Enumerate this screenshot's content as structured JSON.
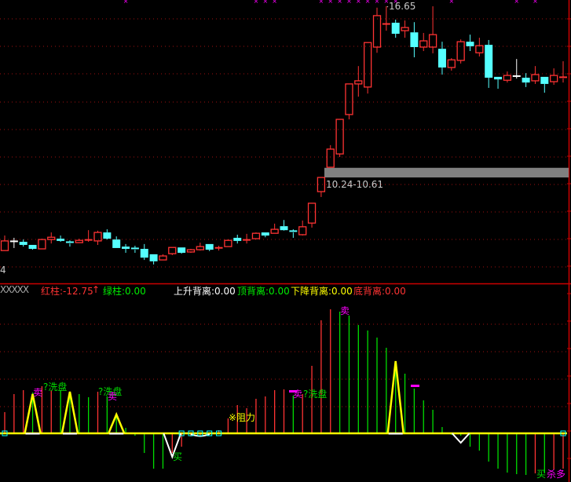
{
  "colors": {
    "up": "#ff3333",
    "down": "#55ffff",
    "doji": "#ffffff",
    "grid": "#a01010",
    "axis": "#cc0000",
    "marker": "#ff00ff",
    "yellow": "#ffff00",
    "green": "#00dd00",
    "magenta": "#ff00ff",
    "gap": "#808080"
  },
  "price_panel": {
    "high_label": "16.65",
    "gap_label": "10.24-10.61",
    "axis_fragment": "4",
    "price_range": [
      7.3,
      16.85
    ]
  },
  "indicator_header": {
    "name": "XXXXX",
    "red_bar": "红柱:-12.75",
    "red_arrow": "↑",
    "green_bar": "绿柱:0.00",
    "rise_divergence": "上升背离:0.00",
    "top_divergence": "顶背离:0.00",
    "fall_divergence": "下降背离:0.00",
    "bottom_divergence": "底背离:0.00"
  },
  "signals": {
    "sell_1": "卖",
    "wash_1": "?洗盘",
    "wash_2": "?洗盘",
    "sell_2": "卖",
    "buy_1": "买",
    "resistance": "※阻力",
    "sell_3": "卖",
    "wash_3": "?洗盘",
    "sell_4": "卖",
    "buy_2": "买",
    "kill_long": "杀多"
  },
  "chart_data": {
    "type": "candlestick",
    "ohlc": [
      [
        8.03,
        8.56,
        8.03,
        8.37
      ],
      [
        8.37,
        8.48,
        8.12,
        8.37
      ],
      [
        8.34,
        8.42,
        8.17,
        8.23
      ],
      [
        8.23,
        8.23,
        8.06,
        8.09
      ],
      [
        8.09,
        8.45,
        8.09,
        8.42
      ],
      [
        8.42,
        8.67,
        8.28,
        8.5
      ],
      [
        8.45,
        8.56,
        8.34,
        8.37
      ],
      [
        8.34,
        8.39,
        8.17,
        8.28
      ],
      [
        8.31,
        8.45,
        8.31,
        8.39
      ],
      [
        8.39,
        8.75,
        8.34,
        8.42
      ],
      [
        8.37,
        8.73,
        8.23,
        8.67
      ],
      [
        8.67,
        8.78,
        8.42,
        8.45
      ],
      [
        8.42,
        8.53,
        8.12,
        8.12
      ],
      [
        8.17,
        8.26,
        7.95,
        8.09
      ],
      [
        8.12,
        8.2,
        7.95,
        8.06
      ],
      [
        8.09,
        8.26,
        7.7,
        7.78
      ],
      [
        7.9,
        7.9,
        7.54,
        7.65
      ],
      [
        7.7,
        7.9,
        7.7,
        7.84
      ],
      [
        7.92,
        8.14,
        7.87,
        8.14
      ],
      [
        8.14,
        8.14,
        7.92,
        7.95
      ],
      [
        7.98,
        8.09,
        7.95,
        8.06
      ],
      [
        8.06,
        8.31,
        8.03,
        8.17
      ],
      [
        8.26,
        8.26,
        8.01,
        8.06
      ],
      [
        8.12,
        8.2,
        8.03,
        8.14
      ],
      [
        8.17,
        8.42,
        8.17,
        8.39
      ],
      [
        8.48,
        8.59,
        8.28,
        8.37
      ],
      [
        8.39,
        8.62,
        8.28,
        8.42
      ],
      [
        8.45,
        8.67,
        8.45,
        8.64
      ],
      [
        8.67,
        8.67,
        8.5,
        8.56
      ],
      [
        8.64,
        8.98,
        8.64,
        8.78
      ],
      [
        8.89,
        9.11,
        8.73,
        8.75
      ],
      [
        8.73,
        8.78,
        8.48,
        8.67
      ],
      [
        8.59,
        9.09,
        8.56,
        8.87
      ],
      [
        9.0,
        9.7,
        8.84,
        9.7
      ],
      [
        10.11,
        10.61,
        9.92,
        10.61
      ],
      [
        10.97,
        11.75,
        10.97,
        11.61
      ],
      [
        11.44,
        12.66,
        11.33,
        12.66
      ],
      [
        12.83,
        13.91,
        12.66,
        13.91
      ],
      [
        13.91,
        14.54,
        13.46,
        14.02
      ],
      [
        13.8,
        15.37,
        13.57,
        15.37
      ],
      [
        15.21,
        16.6,
        15.01,
        16.32
      ],
      [
        16.01,
        16.65,
        15.79,
        16.04
      ],
      [
        16.07,
        16.18,
        15.54,
        15.68
      ],
      [
        15.79,
        16.15,
        15.54,
        15.9
      ],
      [
        15.73,
        16.09,
        14.85,
        15.21
      ],
      [
        15.21,
        15.71,
        15.07,
        15.43
      ],
      [
        15.21,
        16.65,
        14.99,
        15.65
      ],
      [
        15.15,
        15.4,
        14.24,
        14.49
      ],
      [
        14.49,
        14.82,
        14.38,
        14.76
      ],
      [
        14.74,
        15.48,
        14.63,
        15.4
      ],
      [
        15.4,
        15.65,
        15.07,
        15.24
      ],
      [
        15.01,
        15.54,
        14.88,
        15.26
      ],
      [
        15.29,
        15.46,
        13.77,
        14.13
      ],
      [
        14.16,
        14.16,
        13.74,
        14.07
      ],
      [
        14.04,
        14.35,
        13.96,
        14.21
      ],
      [
        14.2,
        14.79,
        14.1,
        14.2
      ],
      [
        14.13,
        14.29,
        13.8,
        13.96
      ],
      [
        14.02,
        14.54,
        13.91,
        14.24
      ],
      [
        14.16,
        14.16,
        13.6,
        13.91
      ],
      [
        13.99,
        14.46,
        13.88,
        14.21
      ],
      [
        14.1,
        14.71,
        13.96,
        14.16
      ]
    ],
    "doji_white": [
      1,
      55
    ],
    "top_markers": [
      13,
      27,
      28,
      29,
      34,
      35,
      36,
      37,
      38,
      39,
      40,
      41,
      42,
      48,
      55,
      57
    ],
    "gap_zone": [
      10.61,
      10.95
    ],
    "indicator": {
      "values": [
        27,
        50,
        55,
        52,
        60,
        55,
        55,
        53,
        50,
        46,
        53,
        47,
        23,
        7,
        -3,
        -25,
        -45,
        -45,
        -25,
        -17,
        -4,
        -3,
        -2,
        4,
        19,
        36,
        32,
        44,
        47,
        55,
        56,
        48,
        50,
        86,
        144,
        158,
        155,
        150,
        138,
        131,
        122,
        109,
        84,
        76,
        57,
        42,
        30,
        8,
        -2,
        -3,
        -17,
        -22,
        -36,
        -45,
        -50,
        -52,
        -53,
        -51,
        -51,
        -46,
        -45
      ],
      "colors": "rrrgrrggggrgggggggrrrrrrrrrrrrrgrrrrgggggggggggggggggggggrgrr",
      "peaks": [
        [
          3,
          50
        ],
        [
          7,
          53
        ],
        [
          12,
          24
        ],
        [
          42,
          92
        ]
      ],
      "dips": [
        [
          18,
          -30
        ],
        [
          49,
          -12
        ]
      ],
      "range": [
        -60,
        160
      ]
    }
  }
}
